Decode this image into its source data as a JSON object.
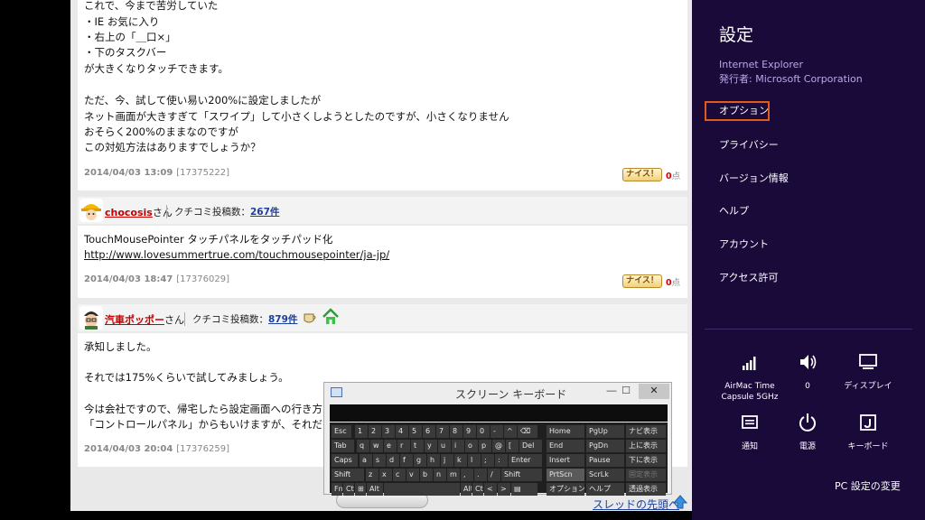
{
  "posts": [
    {
      "lines": [
        "これで、今まで苦労していた",
        "・IE お気に入り",
        "・右上の「＿口×」",
        "・下のタスクバー",
        "が大きくなりタッチできます。",
        "",
        "ただ、今、試して使い易い200%に設定しましたが",
        "ネット画面が大きすぎて「スワイプ」して小さくしようとしたのですが、小さくなりません",
        "おそらく200%のままなのですが",
        "この対処方法はありますでしょうか？"
      ],
      "date": "2014/04/03 13:09",
      "post_id": "[17375222]",
      "nice_label": "ナイス！",
      "points": "0",
      "points_unit": "点"
    },
    {
      "user_name": "chocosis",
      "user_suffix": "さん",
      "count_label": "クチコミ投稿数：",
      "count": "267件",
      "lines": [
        "TouchMousePointer タッチパネルをタッチパッド化"
      ],
      "url": "http://www.lovesummertrue.com/touchmousepointer/ja-jp/",
      "date": "2014/04/03 18:47",
      "post_id": "[17376029]",
      "nice_label": "ナイス！",
      "points": "0",
      "points_unit": "点"
    },
    {
      "user_name": "汽車ポッポー",
      "user_suffix": "さん",
      "count_label": "クチコミ投稿数：",
      "count": "879件",
      "lines": [
        "承知しました。",
        "",
        "それでは175%くらいで試してみましょう。",
        "",
        "今は会社ですので、帰宅したら設定画面への行き方",
        "「コントロールパネル」からもいけますが、それだとア"
      ],
      "date": "2014/04/03 20:04",
      "post_id": "[17376259]"
    }
  ],
  "bottom_link": "スレッドの先頭へ",
  "osk": {
    "title": "スクリーン キーボード",
    "min": "―",
    "max": "☐",
    "close": "✕",
    "rows": [
      [
        "Esc",
        "1",
        "2",
        "3",
        "4",
        "5",
        "6",
        "7",
        "8",
        "9",
        "0",
        "-",
        "^",
        "⌫",
        "Home",
        "PgUp",
        "ナビ表示"
      ],
      [
        "Tab",
        "q",
        "w",
        "e",
        "r",
        "t",
        "y",
        "u",
        "i",
        "o",
        "p",
        "@",
        "[",
        "Del",
        "End",
        "PgDn",
        "上に表示"
      ],
      [
        "Caps",
        "a",
        "s",
        "d",
        "f",
        "g",
        "h",
        "j",
        "k",
        "l",
        ";",
        ":",
        "Enter",
        "Insert",
        "Pause",
        "下に表示"
      ],
      [
        "Shift",
        "z",
        "x",
        "c",
        "v",
        "b",
        "n",
        "m",
        ",",
        ".",
        "/",
        "Shift",
        "PrtScn",
        "ScrLk",
        "固定表示"
      ],
      [
        "Fn",
        "Ctrl",
        "⊞",
        "Alt",
        "",
        "Alt",
        "Ctrl",
        "<",
        ">",
        "▤",
        "オプション",
        "ヘルプ",
        "透過表示"
      ]
    ]
  },
  "charms": {
    "heading": "設定",
    "app_name": "Internet Explorer",
    "publisher": "発行者: Microsoft Corporation",
    "menu": [
      "オプション",
      "プライバシー",
      "バージョン情報",
      "ヘルプ",
      "アカウント",
      "アクセス許可"
    ],
    "tiles": [
      {
        "icon": "wifi-signal-icon",
        "label1": "AirMac Time",
        "label2": "Capsule 5GHz"
      },
      {
        "icon": "speaker-volume-icon",
        "label1": "0",
        "label2": ""
      },
      {
        "icon": "display-icon",
        "label1": "ディスプレイ",
        "label2": ""
      },
      {
        "icon": "notifications-icon",
        "label1": "通知",
        "label2": ""
      },
      {
        "icon": "power-icon",
        "label1": "電源",
        "label2": ""
      },
      {
        "icon": "keyboard-icon",
        "label1": "キーボード",
        "label2": ""
      }
    ],
    "pc_settings": "PC 設定の変更",
    "accent": "#e35b1b",
    "background": "#190a3a"
  }
}
